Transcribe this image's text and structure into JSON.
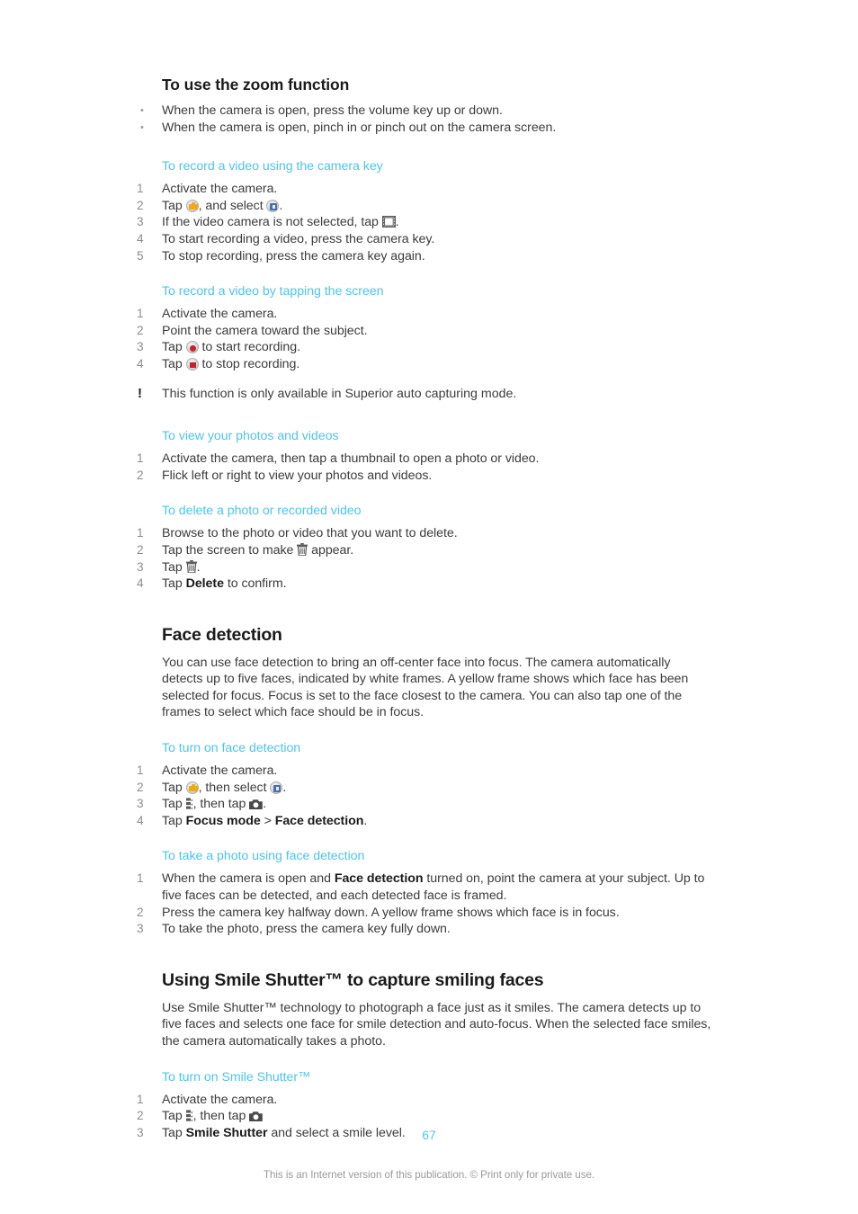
{
  "document": {
    "page_number": "67",
    "footer_note": "This is an Internet version of this publication. © Print only for private use.",
    "accent_color": "#4ec4ea",
    "body_color": "#3c3c3c",
    "heading_color": "#1a1a1a"
  },
  "sections": {
    "zoom_function": {
      "heading": "To use the zoom function",
      "bullets": [
        "When the camera is open, press the volume key up or down.",
        "When the camera is open, pinch in or pinch out on the camera screen."
      ]
    },
    "record_video_camera_key": {
      "heading": "To record a video using the camera key",
      "steps": [
        {
          "num": "1",
          "pre": "Activate the camera.",
          "post": ""
        },
        {
          "num": "2",
          "pre": "Tap ",
          "mid": ", and select ",
          "post": "."
        },
        {
          "num": "3",
          "pre": "If the video camera is not selected, tap ",
          "post": "."
        },
        {
          "num": "4",
          "pre": "To start recording a video, press the camera key.",
          "post": ""
        },
        {
          "num": "5",
          "pre": "To stop recording, press the camera key again.",
          "post": ""
        }
      ]
    },
    "record_video_tapping": {
      "heading": "To record a video by tapping the screen",
      "steps": [
        {
          "num": "1",
          "pre": "Activate the camera.",
          "post": ""
        },
        {
          "num": "2",
          "pre": "Point the camera toward the subject.",
          "post": ""
        },
        {
          "num": "3",
          "pre": "Tap ",
          "post": " to start recording."
        },
        {
          "num": "4",
          "pre": "Tap ",
          "post": " to stop recording."
        }
      ],
      "note": "This function is only available in Superior auto capturing mode.",
      "note_icon": "!"
    },
    "view_photos_videos": {
      "heading": "To view your photos and videos",
      "steps": [
        {
          "num": "1",
          "text": "Activate the camera, then tap a thumbnail to open a photo or video."
        },
        {
          "num": "2",
          "text": "Flick left or right to view your photos and videos."
        }
      ]
    },
    "delete_photo_video": {
      "heading": "To delete a photo or recorded video",
      "steps": [
        {
          "num": "1",
          "pre": "Browse to the photo or video that you want to delete.",
          "post": ""
        },
        {
          "num": "2",
          "pre": "Tap the screen to make ",
          "post": " appear."
        },
        {
          "num": "3",
          "pre": "Tap ",
          "post": "."
        },
        {
          "num": "4",
          "pre": "Tap ",
          "bold": "Delete",
          "post": " to confirm."
        }
      ]
    },
    "face_detection": {
      "heading": "Face detection",
      "body": "You can use face detection to bring an off-center face into focus. The camera automatically detects up to five faces, indicated by white frames. A yellow frame shows which face has been selected for focus. Focus is set to the face closest to the camera. You can also tap one of the frames to select which face should be in focus."
    },
    "turn_on_face_detection": {
      "heading": "To turn on face detection",
      "steps": [
        {
          "num": "1",
          "pre": "Activate the camera.",
          "post": ""
        },
        {
          "num": "2",
          "pre": "Tap ",
          "mid": ", then select ",
          "post": "."
        },
        {
          "num": "3",
          "pre": "Tap ",
          "mid": ", then tap ",
          "post": "."
        },
        {
          "num": "4",
          "pre": "Tap ",
          "bold1": "Focus mode",
          "mid": " > ",
          "bold2": "Face detection",
          "post": "."
        }
      ]
    },
    "take_photo_face_detection": {
      "heading": "To take a photo using face detection",
      "steps": [
        {
          "num": "1",
          "pre": "When the camera is open and ",
          "bold": "Face detection",
          "post": " turned on, point the camera at your subject. Up to five faces can be detected, and each detected face is framed."
        },
        {
          "num": "2",
          "text": "Press the camera key halfway down. A yellow frame shows which face is in focus."
        },
        {
          "num": "3",
          "text": "To take the photo, press the camera key fully down."
        }
      ]
    },
    "smile_shutter": {
      "heading": "Using Smile Shutter™ to capture smiling faces",
      "body": "Use Smile Shutter™ technology to photograph a face just as it smiles. The camera detects up to five faces and selects one face for smile detection and auto-focus. When the selected face smiles, the camera automatically takes a photo."
    },
    "turn_on_smile_shutter": {
      "heading": "To turn on Smile Shutter™",
      "steps": [
        {
          "num": "1",
          "pre": "Activate the camera.",
          "post": ""
        },
        {
          "num": "2",
          "pre": "Tap ",
          "mid": ", then tap ",
          "post": ""
        },
        {
          "num": "3",
          "pre": "Tap ",
          "bold": "Smile Shutter",
          "post": " and select a smile level."
        }
      ]
    }
  },
  "icons": {
    "capture_mode": "capture-mode-icon",
    "mode_selector": "mode-selector-icon",
    "video_camera": "video-camera-icon",
    "record": "record-button-icon",
    "stop": "stop-button-icon",
    "trash": "trash-icon",
    "settings": "settings-icon",
    "camera": "camera-icon"
  },
  "bullet_char": "•"
}
